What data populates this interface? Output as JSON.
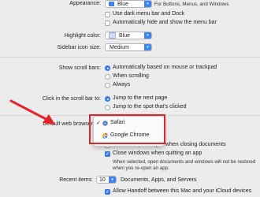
{
  "appearance": {
    "label": "Appearance:",
    "value": "Blue",
    "hint": "For Buttons, Menus, and Windows",
    "dark_menu": "Use dark menu bar and Dock",
    "auto_hide": "Automatically hide and show the menu bar"
  },
  "highlight": {
    "label": "Highlight color:",
    "value": "Blue"
  },
  "sidebar": {
    "label": "Sidebar icon size:",
    "value": "Medium"
  },
  "scroll_bars": {
    "label": "Show scroll bars:",
    "options": [
      "Automatically based on mouse or trackpad",
      "When scrolling",
      "Always"
    ]
  },
  "click_scroll": {
    "label": "Click in the scroll bar to:",
    "options": [
      "Jump to the next page",
      "Jump to the spot that's clicked"
    ]
  },
  "browser": {
    "label": "Default web browser",
    "options": [
      "Safari",
      "Google Chrome"
    ],
    "selected_mark": "✓"
  },
  "documents": {
    "ask_keep": "Ask to keep changes when closing documents",
    "close_windows": "Close windows when quitting an app",
    "note_line1": "When selected, open documents and windows will not be restored",
    "note_line2": "when you re-open an app."
  },
  "recent": {
    "label": "Recent items:",
    "value": "10",
    "suffix": "Documents, Apps, and Servers"
  },
  "handoff": {
    "label": "Allow Handoff between this Mac and your iCloud devices"
  },
  "colors": {
    "accent": "#3d85f4",
    "highlight_box": "#d9272e",
    "arrow": "#e3242b"
  }
}
